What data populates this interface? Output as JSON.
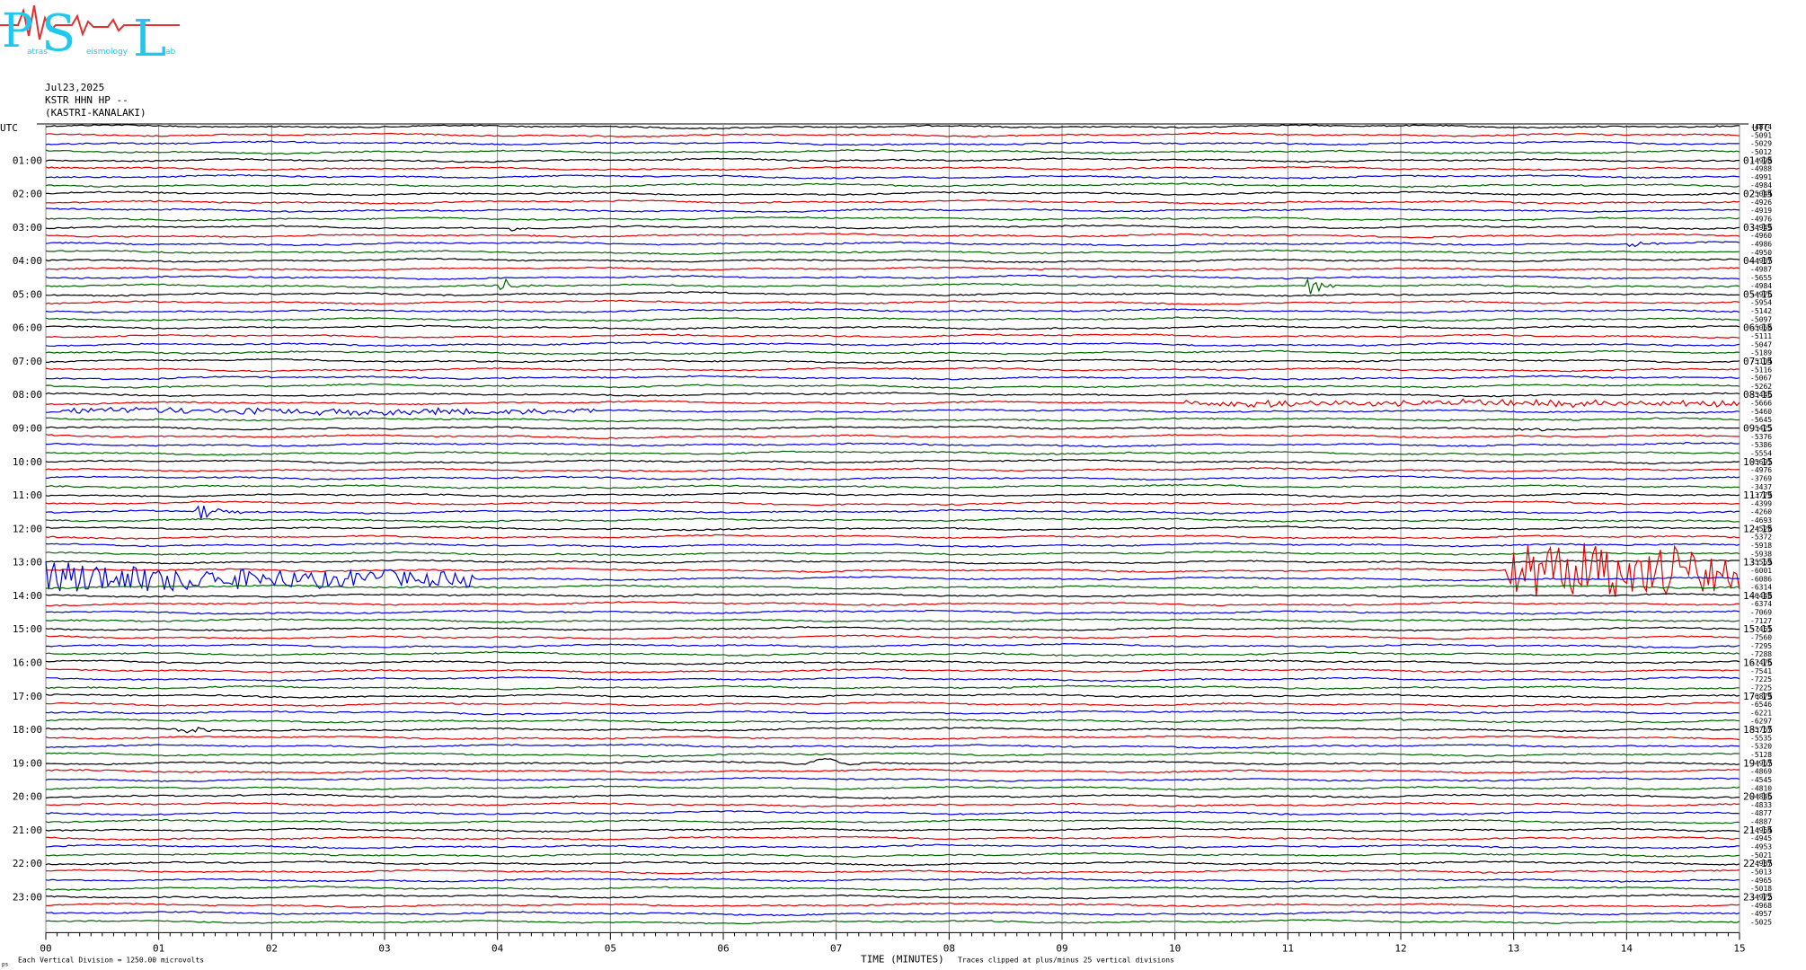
{
  "logo": {
    "letters": [
      "P",
      "S",
      "L"
    ],
    "words": [
      "atras",
      "eismology",
      "ab"
    ],
    "colors": {
      "main": "#1ec8ee",
      "wave": "#e23030"
    }
  },
  "header": {
    "date": "Jul23,2025",
    "station": "KSTR HHN HP --",
    "location": "(KASTRI-KANALAKI)"
  },
  "left_corner_label": "UTC",
  "right_corner_label": "UTC",
  "footer": {
    "xlabel": "TIME (MINUTES)",
    "division_note": "Each Vertical Division = 1250.00 microvolts",
    "clip_note": "Traces clipped at plus/minus 25 vertical divisions",
    "corner_mark": "ps"
  },
  "chart_data": {
    "type": "line",
    "title": "",
    "xlabel": "TIME (MINUTES)",
    "ylabel": "",
    "x_ticks": [
      "00",
      "01",
      "02",
      "03",
      "04",
      "05",
      "06",
      "07",
      "08",
      "09",
      "10",
      "11",
      "12",
      "13",
      "14",
      "15"
    ],
    "xlim": [
      0,
      15
    ],
    "trace_minutes": 15,
    "traces_per_hour": 4,
    "trace_colors": [
      "#000000",
      "#e00000",
      "#0000e0",
      "#006400"
    ],
    "left_hour_labels": [
      "01:00",
      "02:00",
      "03:00",
      "04:00",
      "05:00",
      "06:00",
      "07:00",
      "08:00",
      "09:00",
      "10:00",
      "11:00",
      "12:00",
      "13:00",
      "14:00",
      "15:00",
      "16:00",
      "17:00",
      "18:00",
      "19:00",
      "20:00",
      "21:00",
      "22:00",
      "23:00"
    ],
    "right_hour_labels": [
      "01:15",
      "02:15",
      "03:15",
      "04:15",
      "05:15",
      "06:15",
      "07:15",
      "08:15",
      "09:15",
      "10:15",
      "11:15",
      "12:15",
      "13:15",
      "14:15",
      "15:15",
      "16:15",
      "17:15",
      "18:15",
      "19:15",
      "20:15",
      "21:15",
      "22:15",
      "23:15"
    ],
    "trace_offsets": [
      "-4874",
      "-5091",
      "-5029",
      "-5012",
      "-4998",
      "-4988",
      "-4991",
      "-4984",
      "-5044",
      "-4926",
      "-4919",
      "-4976",
      "-4949",
      "-4960",
      "-4986",
      "-4950",
      "-4937",
      "-4987",
      "-5655",
      "-4984",
      "-4976",
      "-5954",
      "-5142",
      "-5097",
      "-5060",
      "-5111",
      "-5047",
      "-5189",
      "-5104",
      "-5116",
      "-5067",
      "-5262",
      "-5446",
      "-5666",
      "-5460",
      "-5645",
      "-5425",
      "-5376",
      "-5386",
      "-5554",
      "-5691",
      "-4976",
      "-3769",
      "-3437",
      "-3779",
      "-4399",
      "-4260",
      "-4693",
      "-4520",
      "-5372",
      "-5918",
      "-5938",
      "-5559",
      "-6001",
      "-6086",
      "-6314",
      "-6448",
      "-6374",
      "-7069",
      "-7127",
      "-7461",
      "-7560",
      "-7295",
      "-7288",
      "-7476",
      "-7541",
      "-7225",
      "-7225",
      "-6879",
      "-6546",
      "-6221",
      "-6297",
      "-5767",
      "-5535",
      "-5320",
      "-5128",
      "-4967",
      "-4869",
      "-4545",
      "-4810",
      "-4846",
      "-4833",
      "-4877",
      "-4887",
      "-4964",
      "-4945",
      "-4953",
      "-5021",
      "-4987",
      "-5013",
      "-4965",
      "-5018",
      "-4972",
      "-4968",
      "-4957",
      "-5025"
    ],
    "events": [
      {
        "trace": 2,
        "minute": 6.8,
        "duration": 0.3,
        "amplitude": 3,
        "kind": "local"
      },
      {
        "trace": 6,
        "minute": 11.2,
        "duration": 0.1,
        "amplitude": 2,
        "kind": "local"
      },
      {
        "trace": 12,
        "minute": 4.1,
        "duration": 0.3,
        "amplitude": 3,
        "kind": "local"
      },
      {
        "trace": 14,
        "minute": 14.0,
        "duration": 0.6,
        "amplitude": 7,
        "kind": "local"
      },
      {
        "trace": 19,
        "minute": 4.0,
        "duration": 0.5,
        "amplitude": 12,
        "kind": "local"
      },
      {
        "trace": 19,
        "minute": 11.15,
        "duration": 0.45,
        "amplitude": 20,
        "kind": "local"
      },
      {
        "trace": 34,
        "minute": 0.1,
        "duration": 4.8,
        "amplitude": 4,
        "kind": "noise"
      },
      {
        "trace": 33,
        "minute": 10.1,
        "duration": 4.9,
        "amplitude": 4,
        "kind": "noise"
      },
      {
        "trace": 36,
        "minute": 13.0,
        "duration": 1.0,
        "amplitude": 3,
        "kind": "local"
      },
      {
        "trace": 46,
        "minute": 1.3,
        "duration": 0.8,
        "amplitude": 12,
        "kind": "local"
      },
      {
        "trace": 54,
        "minute": 0.0,
        "duration": 3.8,
        "amplitude": 20,
        "kind": "surface"
      },
      {
        "trace": 53,
        "minute": 12.95,
        "duration": 2.05,
        "amplitude": 36,
        "kind": "noise"
      },
      {
        "trace": 72,
        "minute": 1.15,
        "duration": 0.6,
        "amplitude": 10,
        "kind": "local"
      },
      {
        "trace": 71,
        "minute": 11.95,
        "duration": 0.3,
        "amplitude": 5,
        "kind": "local"
      },
      {
        "trace": 76,
        "minute": 6.5,
        "duration": 0.8,
        "amplitude": 4,
        "kind": "long"
      },
      {
        "trace": 88,
        "minute": 13.8,
        "duration": 0.1,
        "amplitude": 3,
        "kind": "local"
      }
    ]
  }
}
